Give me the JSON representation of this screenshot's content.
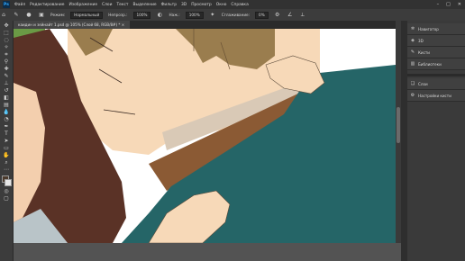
{
  "app": {
    "logo_text": "Ps"
  },
  "menu": {
    "items": [
      "Файл",
      "Редактирование",
      "Изображение",
      "Слои",
      "Текст",
      "Выделение",
      "Фильтр",
      "3D",
      "Просмотр",
      "Окно",
      "Справка"
    ]
  },
  "options": {
    "mode_label": "Режим:",
    "mode_value": "Нормальный",
    "opacity_label": "Непрозр.:",
    "opacity_value": "100%",
    "pressure_label": "Наж.:",
    "pressure_value": "100%",
    "smoothing_label": "Сглаживание:",
    "smoothing_value": "0%"
  },
  "document": {
    "tab_title": "каидин и зейнайт 1.psd @ 105% (Слой 68, RGB/8#) *",
    "tab_close": "×"
  },
  "panels": {
    "group1": [
      {
        "label": "Навигатор",
        "icon": "compass-icon"
      },
      {
        "label": "3D",
        "icon": "cube-icon"
      },
      {
        "label": "Кисти",
        "icon": "brush-icon"
      },
      {
        "label": "Библиотеки",
        "icon": "library-icon"
      }
    ],
    "group2": [
      {
        "label": "Слои",
        "icon": "layers-icon"
      },
      {
        "label": "Настройки кисти",
        "icon": "brush-settings-icon"
      }
    ]
  },
  "colors": {
    "menubar": "#323232",
    "panel_bg": "#3a3a3a",
    "skin": "#f7d9b8",
    "hair_light": "#9a7d4e",
    "shirt": "#256567",
    "dark_hair": "#5a3226"
  }
}
